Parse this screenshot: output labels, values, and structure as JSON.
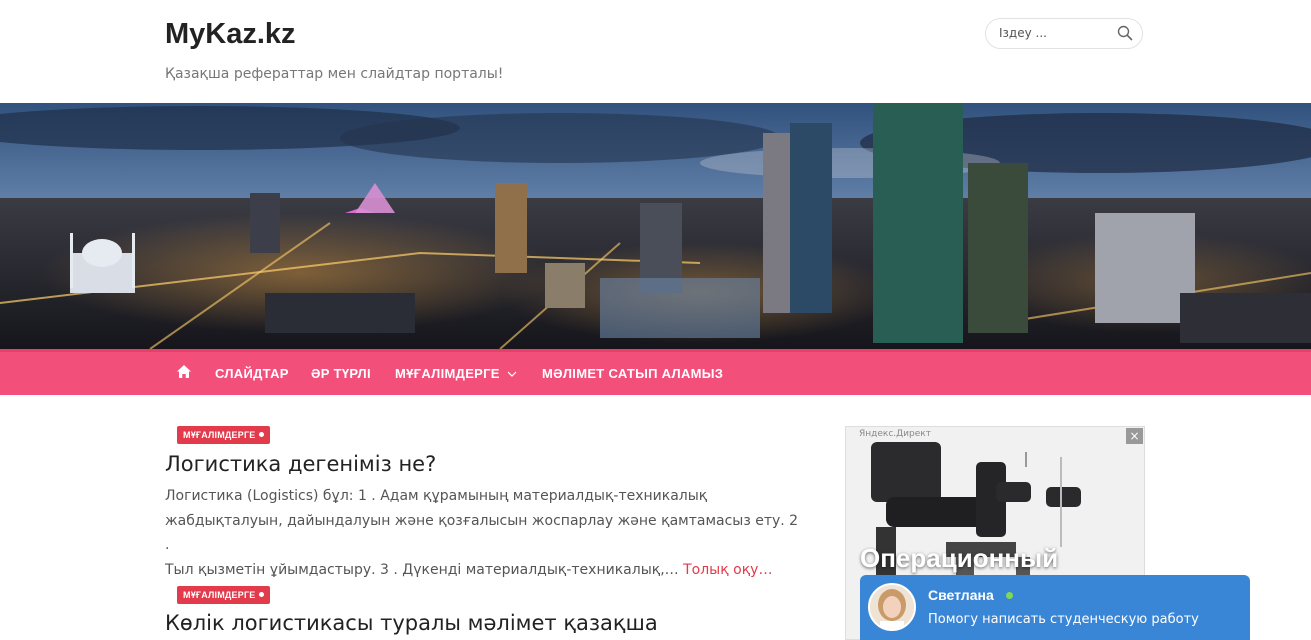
{
  "header": {
    "site_title": "MyKaz.kz",
    "site_description": "Қазақша рефераттар мен слайдтар порталы!",
    "search_placeholder": "Іздеу ..."
  },
  "nav": {
    "items": [
      {
        "label": "СЛАЙДТАР"
      },
      {
        "label": "ӘР ТҮРЛІ"
      },
      {
        "label": "МҰҒАЛІМДЕРГЕ"
      },
      {
        "label": "МӘЛІМЕТ САТЫП АЛАМЫЗ"
      }
    ]
  },
  "posts": [
    {
      "category": "МҰҒАЛІМДЕРГЕ",
      "title": "Логистика дегеніміз не?",
      "excerpt_line1": "Логистика (Logistics) бұл: 1 . Адам құрамының материалдық-техникалық",
      "excerpt_line2": "жабдықталуын, дайындалуын және қозғалысын жоспарлау және қамтамасыз ету. 2 .",
      "excerpt_line3": "Тыл қызметін ұйымдастыру. 3 . Дүкенді материалдық-техникалық,…",
      "read_more": "Толық оқу…"
    },
    {
      "category": "МҰҒАЛІМДЕРГЕ",
      "title": "Көлік логистикасы туралы мәлімет қазақша"
    }
  ],
  "ad": {
    "label": "Яндекс.Директ",
    "close": "×",
    "headline": "Операционный"
  },
  "chat": {
    "name": "Светлана",
    "message": "Помогу написать студенческую работу"
  },
  "colors": {
    "nav_bg": "#f24f7b",
    "badge_bg": "#e23b4b",
    "chat_bg": "#3a86d6"
  }
}
